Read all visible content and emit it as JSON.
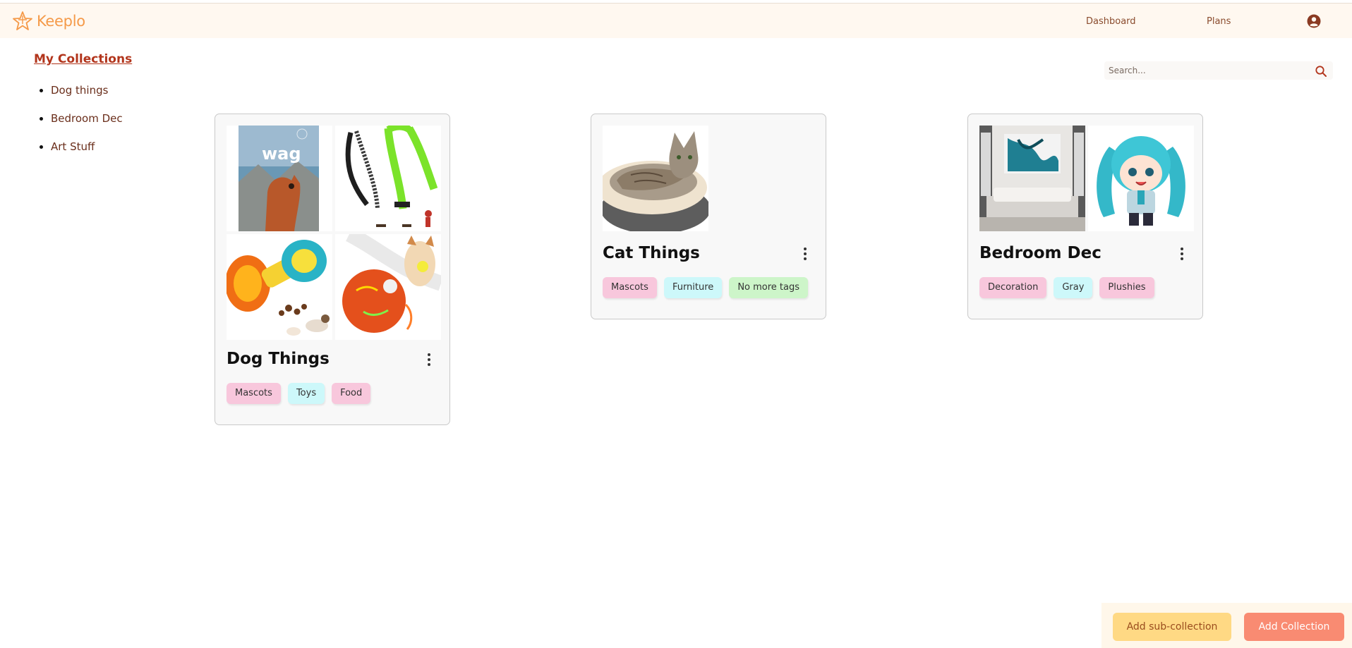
{
  "header": {
    "brand_name": "Keeplo",
    "nav": [
      "Dashboard",
      "Plans"
    ],
    "profile_icon": "user-circle-icon"
  },
  "sidebar": {
    "title": "My Collections",
    "items": [
      {
        "label": "Dog things"
      },
      {
        "label": "Bedroom Dec"
      },
      {
        "label": "Art Stuff"
      }
    ]
  },
  "search": {
    "placeholder": "Search...",
    "value": ""
  },
  "collections": [
    {
      "title": "Dog Things",
      "images": [
        "dog-food-bag-image",
        "dog-leash-image",
        "dog-treat-toy-image",
        "dog-ball-toy-image"
      ],
      "tags": [
        "Mascots",
        "Toys",
        "Food"
      ]
    },
    {
      "title": "Cat Things",
      "images": [
        "cat-bed-image"
      ],
      "tags": [
        "Mascots",
        "Furniture",
        "No more tags"
      ]
    },
    {
      "title": "Bedroom Dec",
      "images": [
        "bedroom-image",
        "plush-doll-image"
      ],
      "tags": [
        "Decoration",
        "Gray",
        "Plushies"
      ]
    }
  ],
  "actions": {
    "add_subcollection": "Add sub-collection",
    "add_collection": "Add Collection"
  },
  "colors": {
    "brand": "#f59a49",
    "accent": "#b2351c",
    "tag_pink": "#f8c7dc",
    "tag_cyan": "#cdf8fa",
    "tag_green": "#cdf5c9",
    "button_sub": "#ffd984",
    "button_add": "#f98b72"
  }
}
